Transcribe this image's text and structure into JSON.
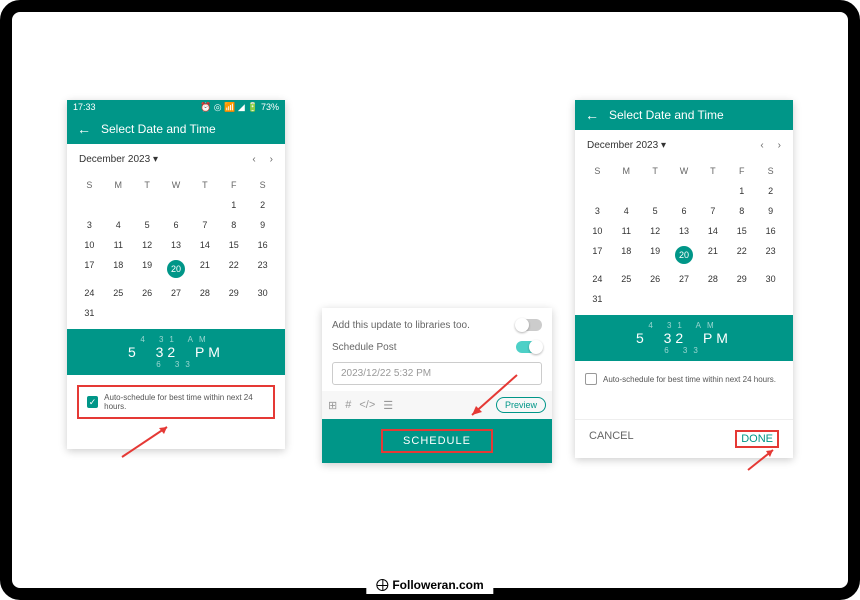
{
  "statusbar": {
    "time": "17:33",
    "battery": "73%"
  },
  "header": {
    "title": "Select Date and Time"
  },
  "calendar": {
    "month_label": "December 2023",
    "dow": [
      "S",
      "M",
      "T",
      "W",
      "T",
      "F",
      "S"
    ],
    "rows": [
      [
        "",
        "",
        "",
        "",
        "",
        "1",
        "2"
      ],
      [
        "3",
        "4",
        "5",
        "6",
        "7",
        "8",
        "9"
      ],
      [
        "10",
        "11",
        "12",
        "13",
        "14",
        "15",
        "16"
      ],
      [
        "17",
        "18",
        "19",
        "20",
        "21",
        "22",
        "23"
      ],
      [
        "24",
        "25",
        "26",
        "27",
        "28",
        "29",
        "30"
      ],
      [
        "31",
        "",
        "",
        "",
        "",
        "",
        ""
      ]
    ],
    "selected": "20"
  },
  "time_left": {
    "above": "4   31   AM",
    "main_h": "5",
    "main_m": "32",
    "main_ap": "PM",
    "below": "6   33"
  },
  "time_right": {
    "above": "4   31   AM",
    "main_h": "5",
    "main_m": "32",
    "main_ap": "PM",
    "below": "6   33"
  },
  "autoschedule_label": "Auto-schedule for best time within next 24 hours.",
  "mid": {
    "libraries_label": "Add this update to libraries too.",
    "schedule_post_label": "Schedule Post",
    "datetime_value": "2023/12/22 5:32 PM",
    "preview_label": "Preview",
    "schedule_button": "SCHEDULE"
  },
  "footer": {
    "cancel": "CANCEL",
    "done": "DONE"
  },
  "watermark": "Followeran.com"
}
